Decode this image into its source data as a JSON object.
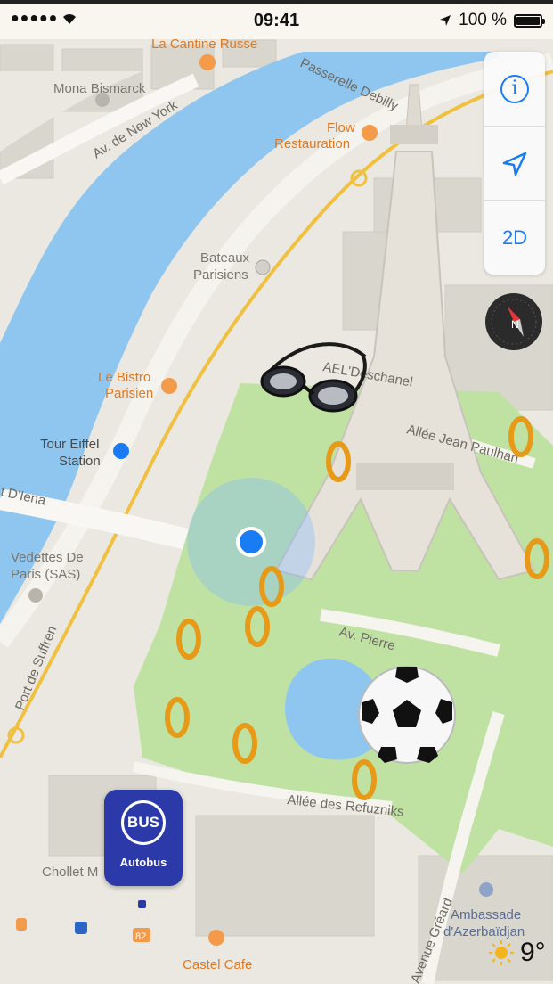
{
  "status_bar": {
    "time": "09:41",
    "battery": "100 %",
    "signal": "●●●●●"
  },
  "controls": {
    "info_glyph": "i",
    "mode_label": "2D"
  },
  "map_labels": {
    "la_cantine_russe": "La Cantine Russe",
    "mona_bismarck": "Mona Bismarck",
    "av_new_york": "Av. de New York",
    "passerelle_debilly": "Passerelle Debilly",
    "flow_1": "Flow",
    "flow_2": "Restauration",
    "bateaux_1": "Bateaux",
    "bateaux_2": "Parisiens",
    "bistro_1": "Le Bistro",
    "bistro_2": "Parisien",
    "tour_eiffel_1": "Tour Eiffel",
    "tour_eiffel_2": "Station",
    "pont_diena": "t D'Iena",
    "vedettes_1": "Vedettes De",
    "vedettes_2": "Paris (SAS)",
    "port_de_suffren": "Port de Suffren",
    "deschanel": "AEL'Deschanel",
    "allee_jean_paulhan": "Allée Jean Paulhan",
    "av_pierre": "Av. Pierre",
    "allee_refuzniks": "Allée des Refuzniks",
    "chollet": "Chollet M",
    "castel_cafe": "Castel Cafe",
    "bus_stop_82": "82",
    "ambassade_1": "Ambassade",
    "ambassade_2": "d'Azerbaïdjan",
    "avenue_greard": "Avenue Gréard"
  },
  "bus_pin": {
    "badge": "BUS",
    "label": "Autobus"
  },
  "weather": {
    "temperature": "9°"
  },
  "colors": {
    "water": "#8ec6f0",
    "park": "#bfe2a3",
    "accent": "#1a7cf5",
    "poi_orange": "#f39b4a",
    "bus_blue": "#2b3aa8",
    "ring_gold": "#e79a18"
  },
  "icons": [
    "info-icon",
    "location-arrow-icon",
    "compass-icon",
    "bus-icon",
    "sun-icon",
    "wifi-icon",
    "battery-icon",
    "user-location-icon",
    "swim-goggles-icon",
    "soccer-ball-icon",
    "ring-icon"
  ]
}
